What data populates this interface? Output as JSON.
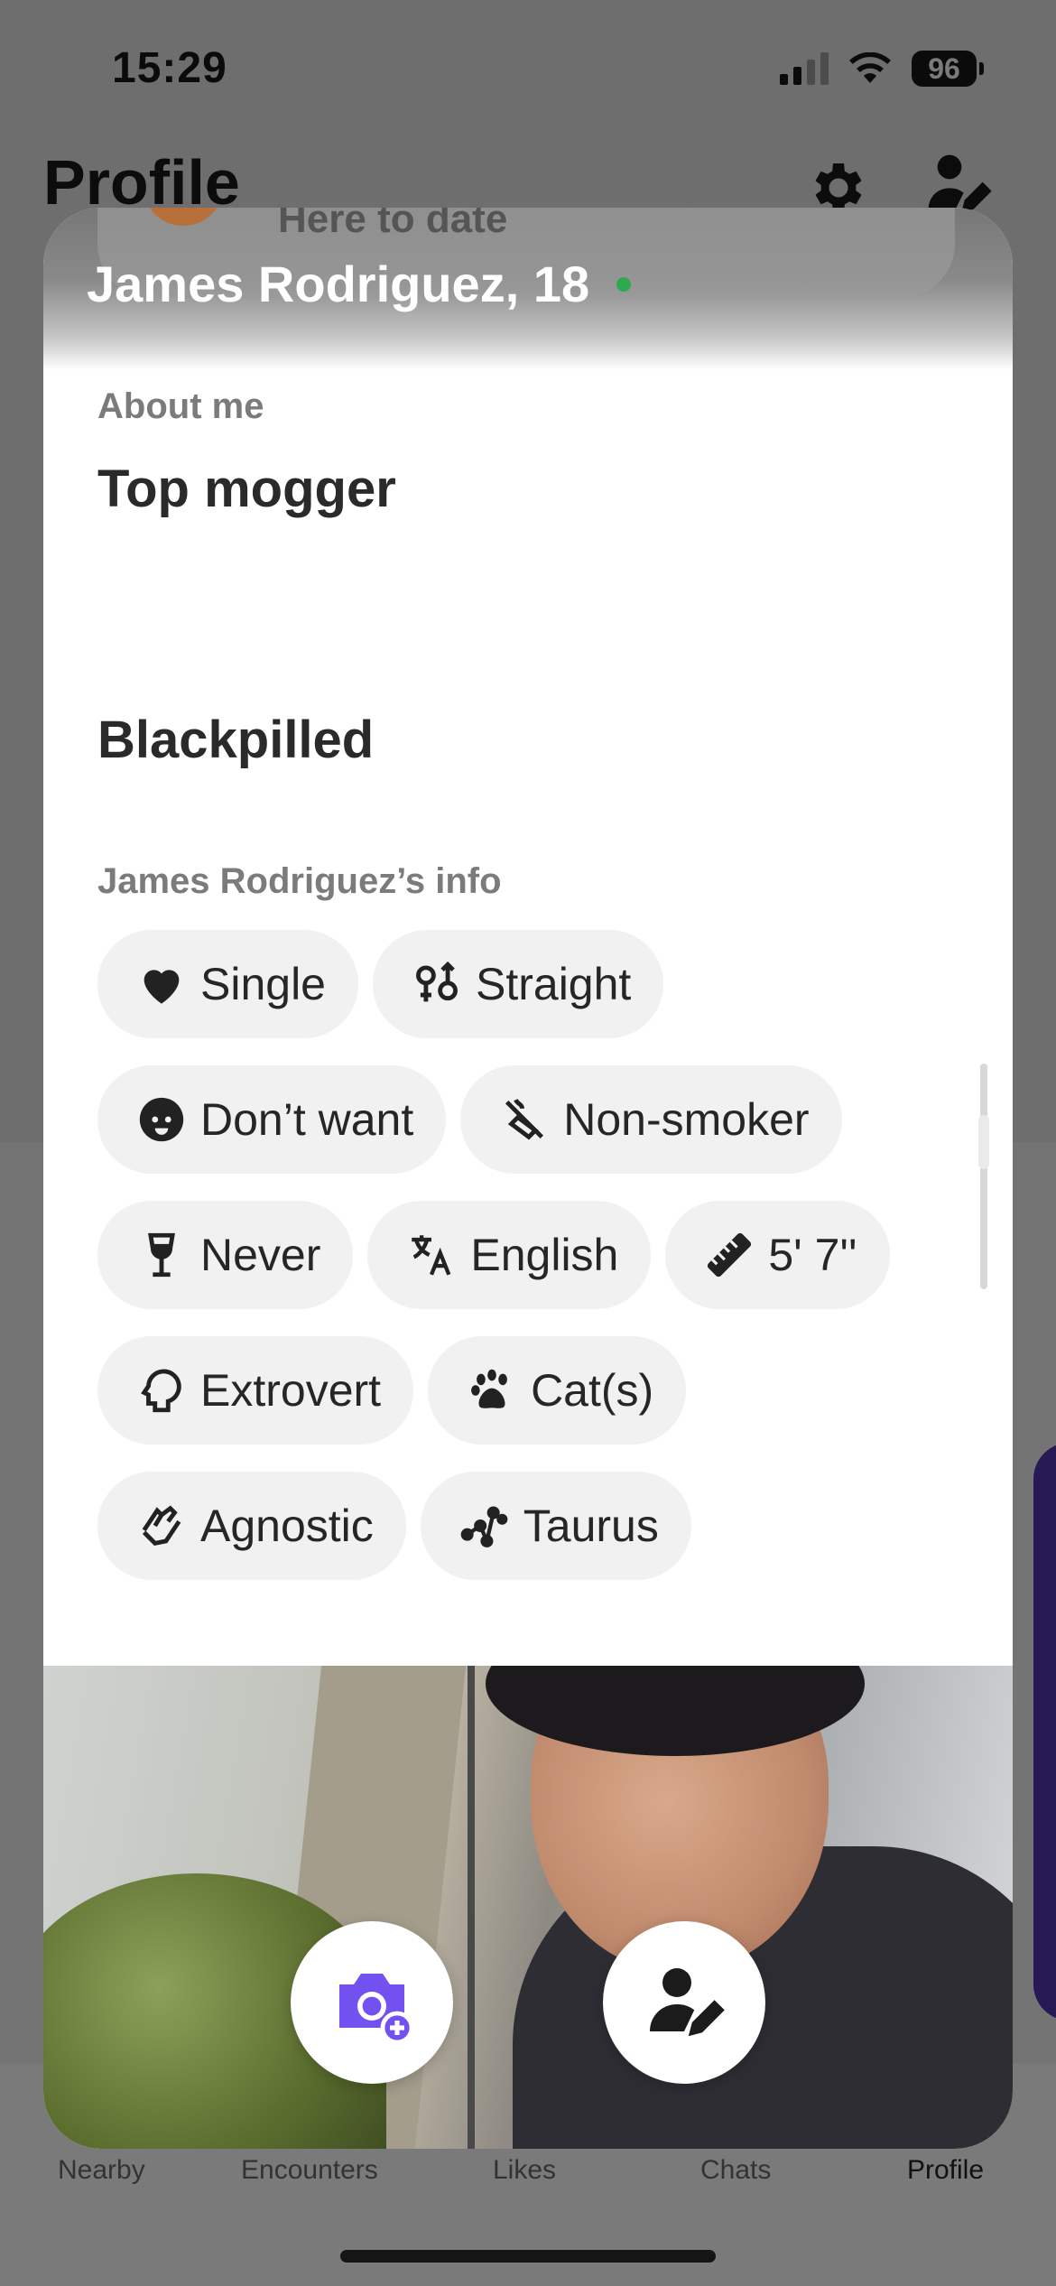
{
  "status_bar": {
    "time": "15:29",
    "battery": "96"
  },
  "background": {
    "title": "Profile",
    "peek_text": "Here to date"
  },
  "profile": {
    "name": "James Rodriguez, 18",
    "about_label": "About me",
    "about_line1": "Top mogger",
    "about_line2": "Blackpilled",
    "info_label": "James Rodriguez’s info",
    "chips": [
      {
        "label": "Single",
        "icon": "heart-icon"
      },
      {
        "label": "Straight",
        "icon": "gender-icon"
      },
      {
        "label": "Don’t want",
        "icon": "baby-icon"
      },
      {
        "label": "Non-smoker",
        "icon": "no-smoking-icon"
      },
      {
        "label": "Never",
        "icon": "wine-glass-icon"
      },
      {
        "label": "English",
        "icon": "translate-icon"
      },
      {
        "label": "5' 7''",
        "icon": "ruler-icon"
      },
      {
        "label": "Extrovert",
        "icon": "head-icon"
      },
      {
        "label": "Cat(s)",
        "icon": "paw-icon"
      },
      {
        "label": "Agnostic",
        "icon": "praying-hands-icon"
      },
      {
        "label": "Taurus",
        "icon": "constellation-icon"
      }
    ]
  },
  "tabs": [
    "Nearby",
    "Encounters",
    "Likes",
    "Chats",
    "Profile"
  ],
  "colors": {
    "accent": "#7350f0",
    "online": "#2fa84f",
    "chip_bg": "#f1f1f1"
  }
}
